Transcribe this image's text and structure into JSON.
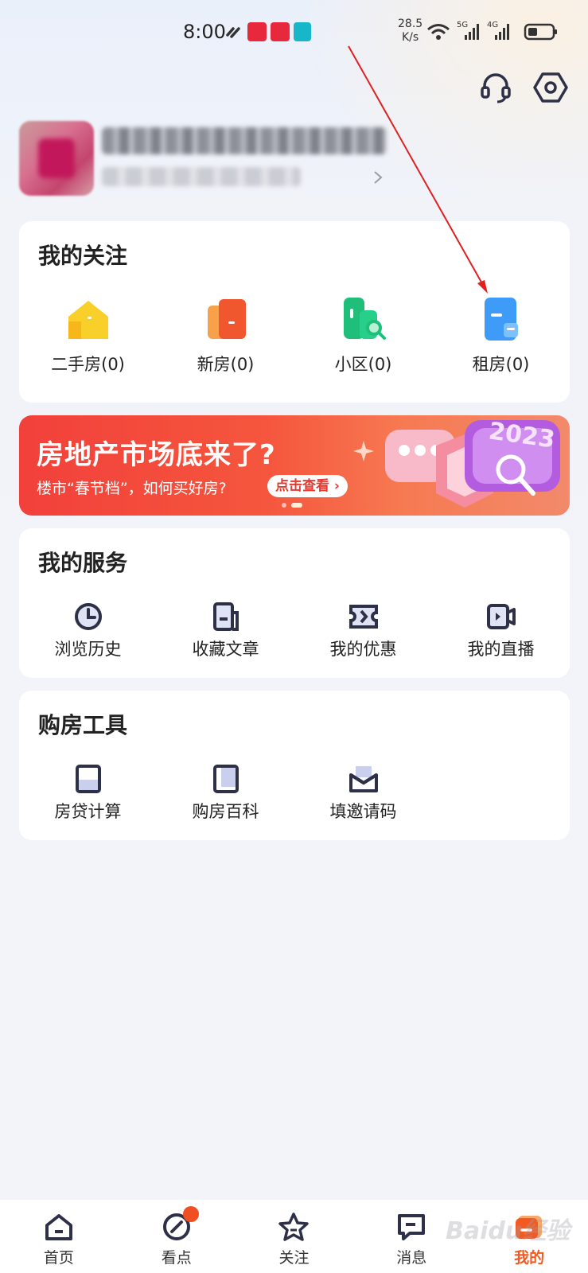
{
  "status_bar": {
    "time": "8:00",
    "net_speed_value": "28.5",
    "net_speed_unit": "K/s",
    "signal_1": "5G",
    "signal_2": "4G"
  },
  "header": {
    "icons": [
      "headset-icon",
      "settings-icon"
    ]
  },
  "favorites": {
    "title": "我的关注",
    "items": [
      {
        "label": "二手房(0)",
        "icon": "secondhand-house-icon",
        "color": "#f7c21e"
      },
      {
        "label": "新房(0)",
        "icon": "new-house-icon",
        "color": "#f1572f"
      },
      {
        "label": "小区(0)",
        "icon": "community-search-icon",
        "color": "#1fbf7a"
      },
      {
        "label": "租房(0)",
        "icon": "rental-house-icon",
        "color": "#2b8ff6"
      }
    ]
  },
  "banner": {
    "title": "房地产市场底来了?",
    "subtitle": "楼市“春节档”，如何买好房?",
    "button": "点击查看",
    "badge_text": "2023"
  },
  "services": {
    "title": "我的服务",
    "items": [
      {
        "label": "浏览历史",
        "icon": "clock-icon"
      },
      {
        "label": "收藏文章",
        "icon": "bookmark-article-icon"
      },
      {
        "label": "我的优惠",
        "icon": "coupon-icon"
      },
      {
        "label": "我的直播",
        "icon": "live-video-icon"
      }
    ]
  },
  "tools": {
    "title": "购房工具",
    "items": [
      {
        "label": "房贷计算",
        "icon": "calculator-icon"
      },
      {
        "label": "购房百科",
        "icon": "book-icon"
      },
      {
        "label": "填邀请码",
        "icon": "invite-envelope-icon"
      }
    ]
  },
  "tabbar": {
    "items": [
      {
        "label": "首页",
        "icon": "home-icon"
      },
      {
        "label": "看点",
        "icon": "compass-icon"
      },
      {
        "label": "关注",
        "icon": "star-icon"
      },
      {
        "label": "消息",
        "icon": "message-icon"
      },
      {
        "label": "我的",
        "icon": "profile-icon"
      }
    ],
    "active_index": 4
  },
  "colors": {
    "accent": "#f25a22",
    "icon_dark": "#2d3047",
    "annotation": "#e02020"
  },
  "watermark": "Baidu经验"
}
